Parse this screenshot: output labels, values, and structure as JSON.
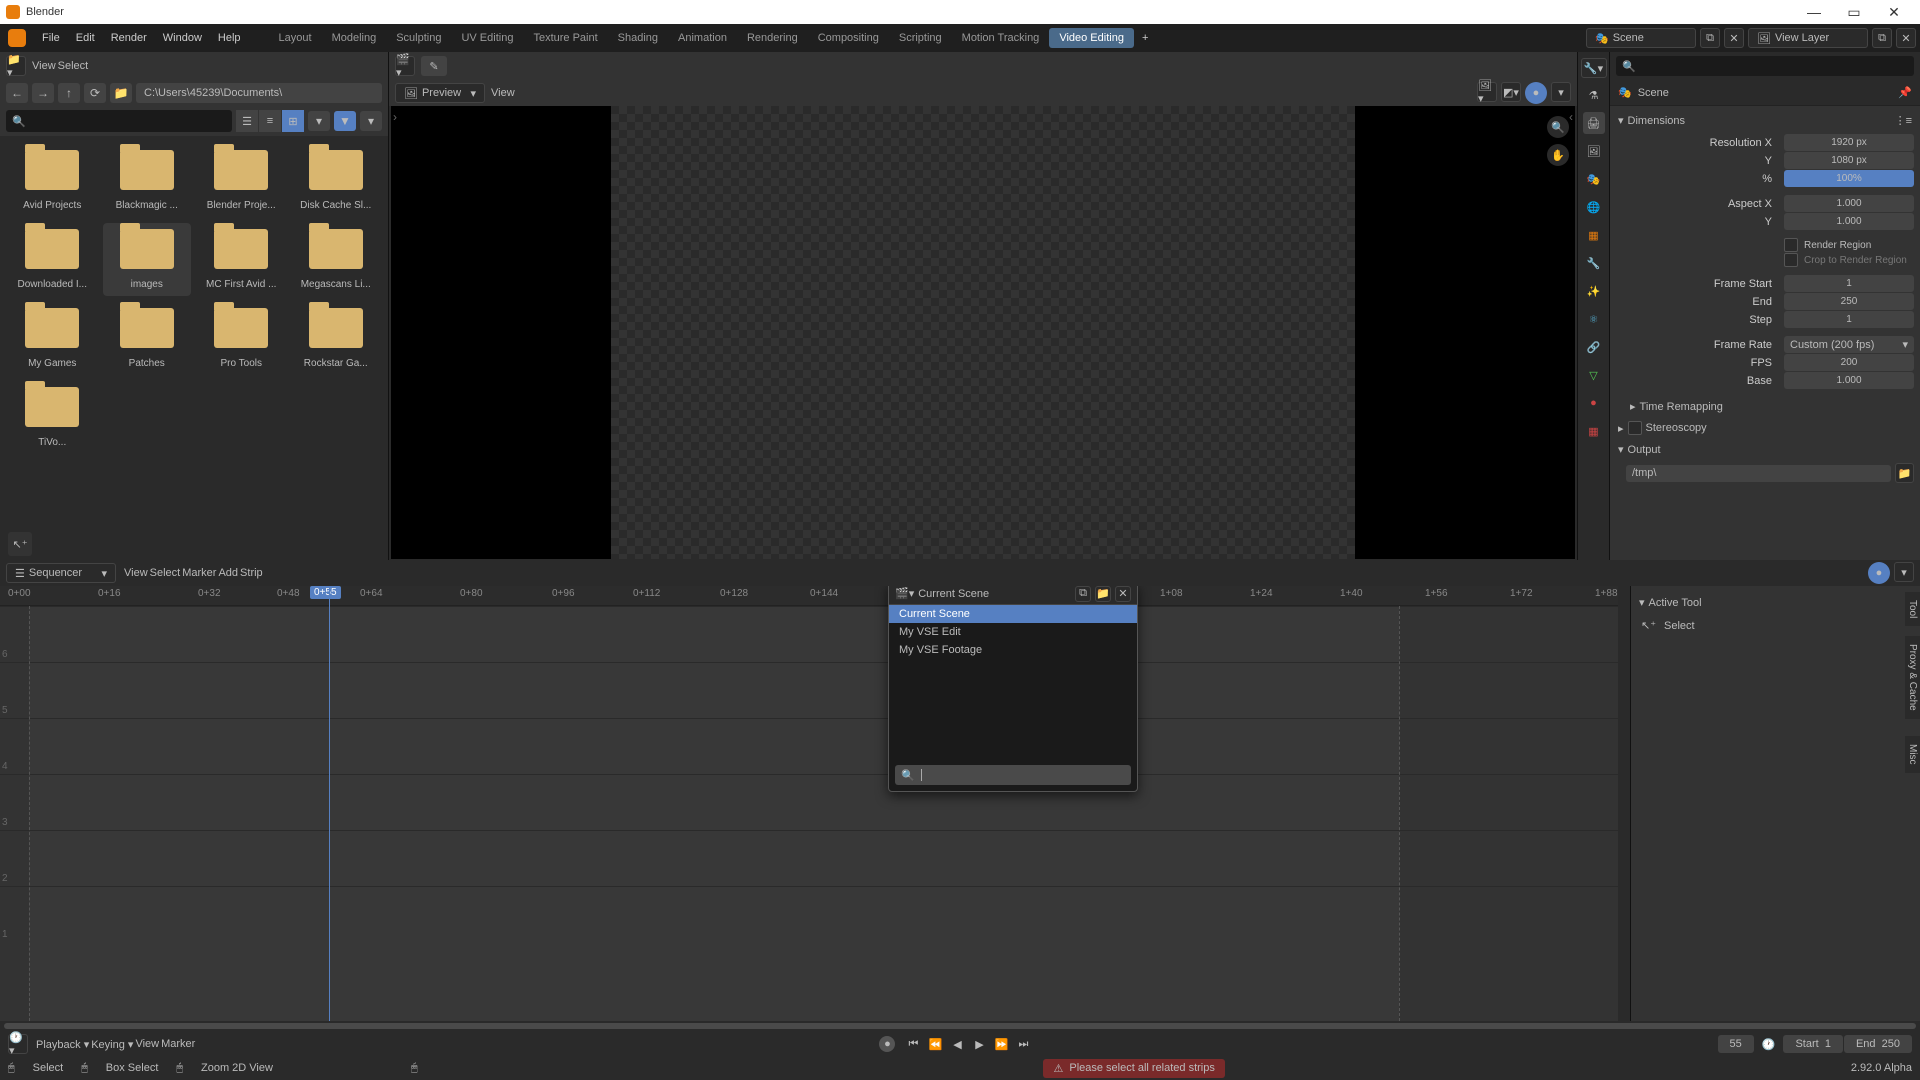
{
  "app_title": "Blender",
  "main_menu": [
    "File",
    "Edit",
    "Render",
    "Window",
    "Help"
  ],
  "workspace_tabs": [
    "Layout",
    "Modeling",
    "Sculpting",
    "UV Editing",
    "Texture Paint",
    "Shading",
    "Animation",
    "Rendering",
    "Compositing",
    "Scripting",
    "Motion Tracking",
    "Video Editing"
  ],
  "active_workspace": "Video Editing",
  "scene_name": "Scene",
  "viewlayer_name": "View Layer",
  "filebrowser": {
    "menu": [
      "View",
      "Select"
    ],
    "path": "C:\\Users\\45239\\Documents\\",
    "folders": [
      "Avid Projects",
      "Blackmagic ...",
      "Blender Proje...",
      "Disk Cache Sl...",
      "Downloaded I...",
      "images",
      "MC First Avid ...",
      "Megascans Li...",
      "My Games",
      "Patches",
      "Pro Tools",
      "Rockstar Ga..."
    ],
    "remaining": [
      "TiVo..."
    ],
    "selected": "images"
  },
  "preview": {
    "mode": "Preview",
    "menu": [
      "View"
    ]
  },
  "props": {
    "scene_label": "Scene",
    "panel1": "Dimensions",
    "res_x_label": "Resolution X",
    "res_x": "1920 px",
    "res_y_label": "Y",
    "res_y": "1080 px",
    "res_pct_label": "%",
    "res_pct": "100%",
    "aspect_x_label": "Aspect X",
    "aspect_x": "1.000",
    "aspect_y_label": "Y",
    "aspect_y": "1.000",
    "render_region": "Render Region",
    "crop_region": "Crop to Render Region",
    "frame_start_label": "Frame Start",
    "frame_start": "1",
    "frame_end_label": "End",
    "frame_end": "250",
    "frame_step_label": "Step",
    "frame_step": "1",
    "frame_rate_label": "Frame Rate",
    "frame_rate": "Custom (200 fps)",
    "fps_label": "FPS",
    "fps": "200",
    "base_label": "Base",
    "base": "1.000",
    "panel2": "Time Remapping",
    "panel3": "Stereoscopy",
    "panel4": "Output",
    "output_path": "/tmp\\"
  },
  "sequencer": {
    "editor": "Sequencer",
    "menu": [
      "View",
      "Select",
      "Marker",
      "Add",
      "Strip"
    ],
    "ruler": [
      "0+00",
      "0+16",
      "0+32",
      "0+48",
      "0+55",
      "0+64",
      "0+80",
      "0+96",
      "0+112",
      "0+128",
      "0+144",
      "1+08",
      "1+24",
      "1+40",
      "1+56",
      "1+72",
      "1+88"
    ],
    "current": "0+55",
    "tracks": [
      "6",
      "5",
      "4",
      "3",
      "2",
      "1"
    ],
    "scene_dd": {
      "header": "Current Scene",
      "items": [
        "Current Scene",
        "My VSE Edit",
        "My VSE Footage"
      ],
      "selected": "Current Scene"
    },
    "side_panel": "Active Tool",
    "side_item": "Select",
    "side_tabs": [
      "Tool",
      "Proxy & Cache",
      "Misc"
    ]
  },
  "playback": {
    "menu": [
      "Playback",
      "Keying",
      "View",
      "Marker"
    ],
    "frame": "55",
    "start_label": "Start",
    "start": "1",
    "end_label": "End",
    "end": "250"
  },
  "status": {
    "select": "Select",
    "box": "Box Select",
    "zoom": "Zoom 2D View",
    "warning": "Please select all related strips",
    "version": "2.92.0 Alpha"
  }
}
